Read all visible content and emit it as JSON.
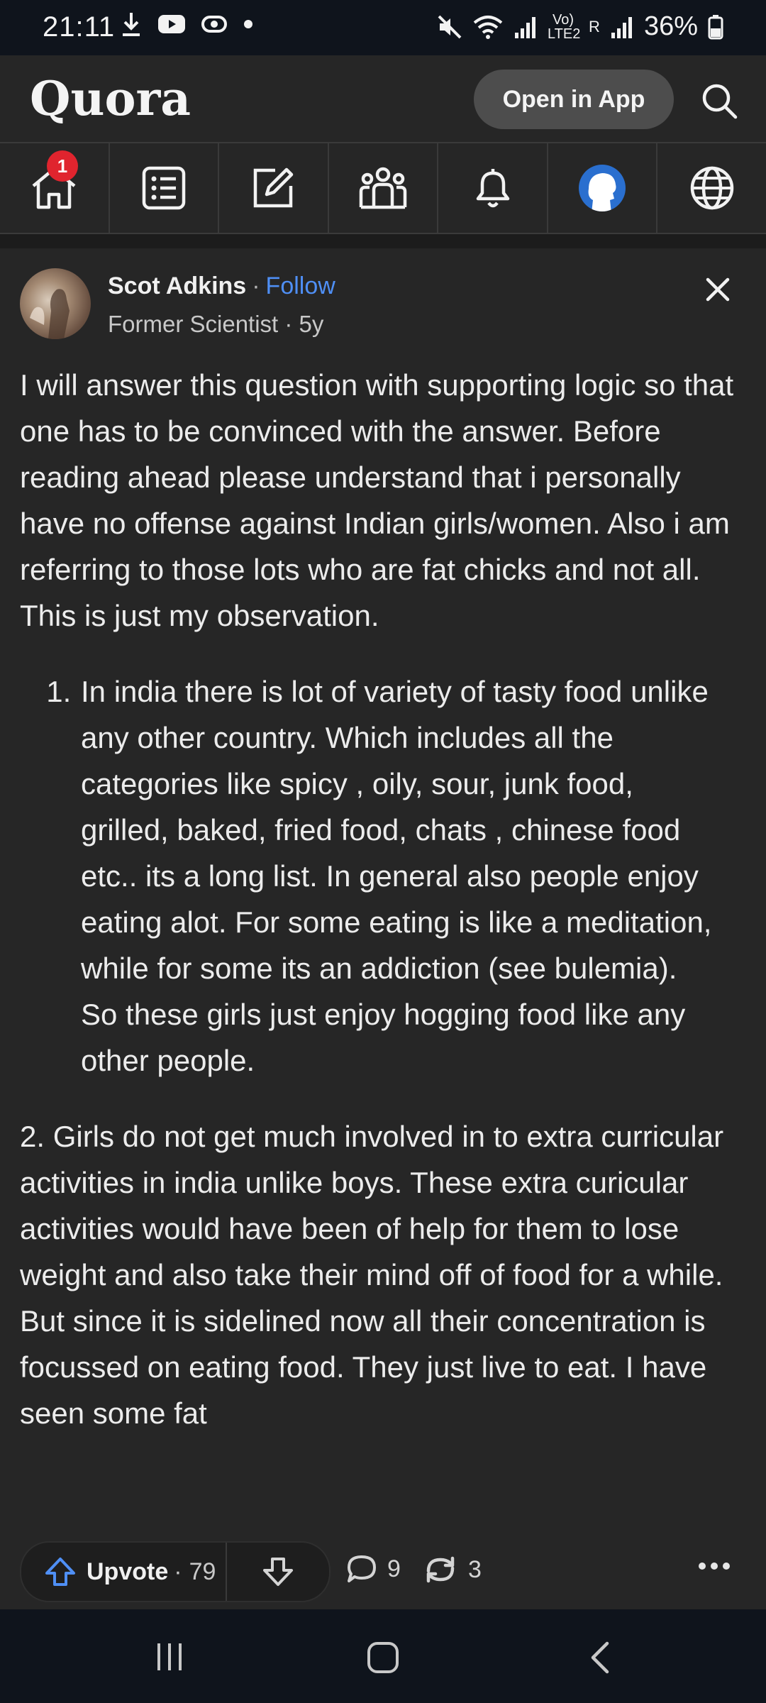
{
  "status_bar": {
    "time": "21:11",
    "battery": "36%",
    "network_label": "Vo) LTE2",
    "sim_label": "R"
  },
  "header": {
    "logo": "Quora",
    "open_in_app": "Open in App"
  },
  "tabs": {
    "home_badge": "1",
    "items": [
      "home-icon",
      "answer-list-icon",
      "write-icon",
      "spaces-icon",
      "notifications-icon",
      "profile-icon",
      "languages-icon"
    ]
  },
  "post": {
    "author_name": "Scot Adkins",
    "separator": "·",
    "follow": "Follow",
    "credential": "Former Scientist · 5y",
    "intro": "I will answer this question with supporting logic so that one has to be convinced with the answer. Before reading ahead please understand that i personally have no offense against Indian girls/women. Also i am referring to those lots who are fat chicks and not all. This is just my observation.",
    "list_item_1": "In india there is lot of variety of tasty food unlike any other country. Which includes all the categories like spicy , oily, sour, junk food, grilled, baked, fried food, chats , chinese food etc.. its a long list. In general also people enjoy eating alot. For some eating is like a meditation, while for some its an addiction (see bulemia). So these girls just enjoy hogging food like any other people.",
    "paragraph_2": "2. Girls do not get much involved in to extra curricular activities in india unlike boys. These extra curicular activities would have been of help for them to lose weight and also take their mind off of food for a while. But since it is sidelined now all their concentration is focussed on eating food. They just live to eat. I have seen some fat"
  },
  "actions": {
    "upvote_label": "Upvote",
    "upvote_separator": "·",
    "upvote_count": "79",
    "comment_count": "9",
    "share_count": "3"
  },
  "colors": {
    "background": "#262626",
    "accent_follow": "#4f8ff5",
    "badge": "#e0242e"
  }
}
